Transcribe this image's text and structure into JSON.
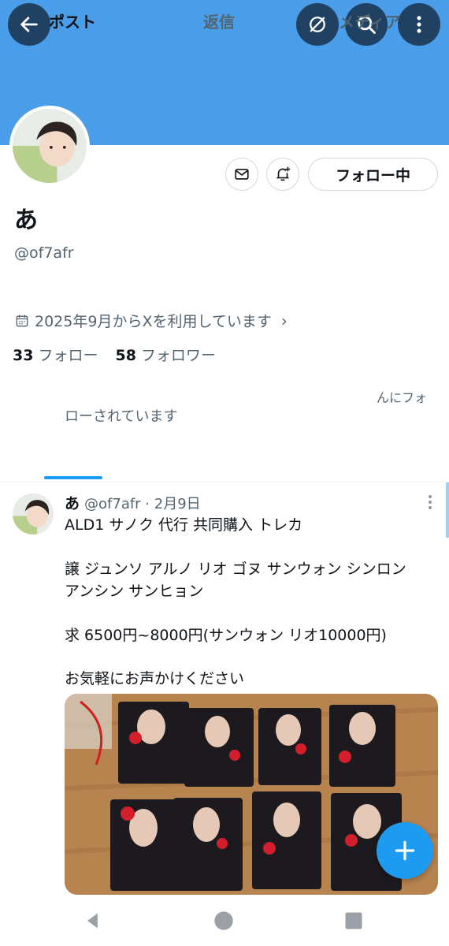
{
  "header": {
    "banner_color": "#4a9de8",
    "icons": [
      "arrow-left-icon",
      "globe-slash-icon",
      "search-icon",
      "more-vertical-icon"
    ]
  },
  "profile": {
    "display_name": "あ",
    "handle": "@of7afr",
    "following_label": "フォロー中",
    "joined": "2025年9月からXを利用しています",
    "following_count": "33",
    "following_label_stat": "フォロー",
    "followers_count": "58",
    "followers_label_stat": "フォロワー",
    "followed_by_fragment": "んにフォ",
    "followed_by_text": "ローされています"
  },
  "tabs": [
    {
      "label": "ポスト"
    },
    {
      "label": "返信"
    },
    {
      "label": "メディア"
    }
  ],
  "post": {
    "name": "あ",
    "meta": "@of7afr · 2月9日",
    "lines": [
      "ALD1 サノク 代行 共同購入 トレカ",
      "譲 ジュンソ アルノ リオ ゴヌ サンウォン シンロン",
      "アンシン サンヒョン",
      "求 6500円~8000円(サンウォン リオ10000円)",
      "お気軽にお声かけください"
    ]
  },
  "colors": {
    "accent": "#1d9bf0",
    "text_primary": "#0f1419",
    "text_secondary": "#536471"
  }
}
